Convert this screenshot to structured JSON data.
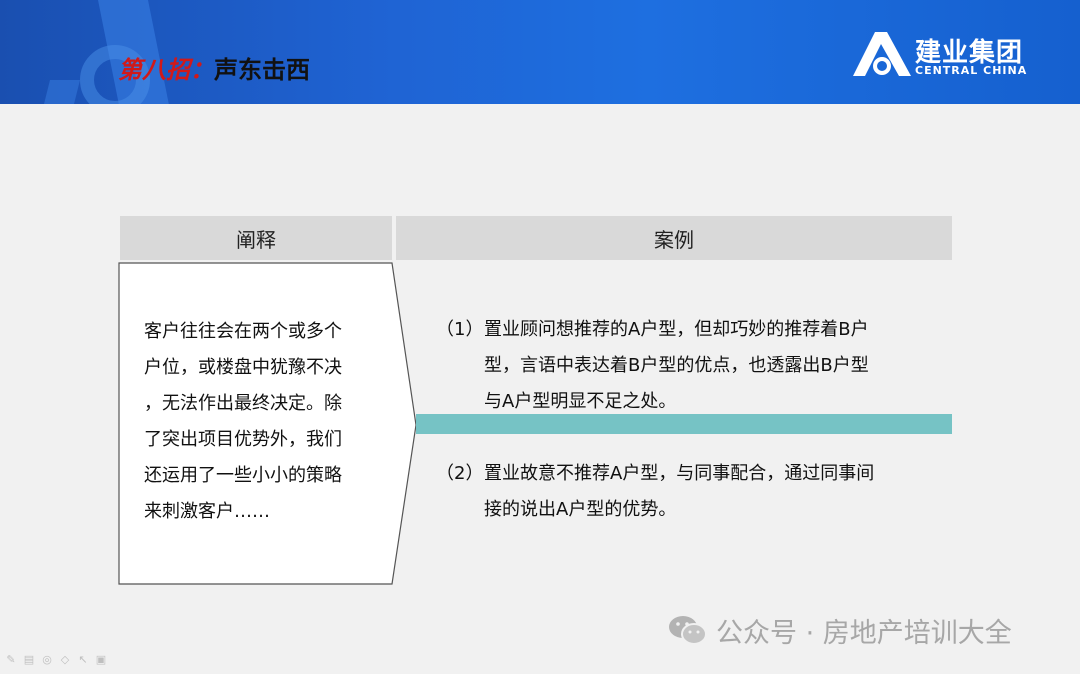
{
  "header": {
    "title_prefix": "第八招：",
    "title_main": "声东击西",
    "logo_zh": "建业集团",
    "logo_en": "CENTRAL CHINA",
    "bg_color": "#1e62d0"
  },
  "table": {
    "header_left": "阐释",
    "header_right": "案例",
    "explanation": "客户往往会在两个或多个\n户位，或楼盘中犹豫不决\n，无法作出最终决定。除\n了突出项目优势外，我们\n还运用了一些小小的策略\n来刺激客户……",
    "cases": [
      {
        "num": "（1）",
        "text": "置业顾问想推荐的A户型，但却巧妙的推荐着B户\n型，言语中表达着B户型的优点，也透露出B户型\n与A户型明显不足之处。"
      },
      {
        "num": "（2）",
        "text": "置业故意不推荐A户型，与同事配合，通过同事间\n接的说出A户型的优势。"
      }
    ],
    "accent_color": "#76c3c5"
  },
  "watermark": {
    "text": "公众号 · 房地产培训大全",
    "icon": "wechat-icon"
  },
  "toolbar": {
    "icons": [
      "pen-icon",
      "slides-icon",
      "pointer-icon",
      "eraser-icon",
      "cursor-icon",
      "camera-icon"
    ]
  }
}
